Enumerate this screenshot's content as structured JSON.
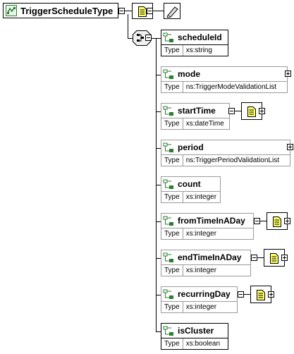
{
  "root": {
    "name": "TriggerScheduleType"
  },
  "type_label": "Type",
  "elements": [
    {
      "name": "scheduleId",
      "type": "xs:string"
    },
    {
      "name": "mode",
      "type": "ns:TriggerModeValidationList"
    },
    {
      "name": "startTime",
      "type": "xs:dateTime"
    },
    {
      "name": "period",
      "type": "ns:TriggerPeriodValidationList"
    },
    {
      "name": "count",
      "type": "xs:integer"
    },
    {
      "name": "fromTimeInADay",
      "type": "xs:integer"
    },
    {
      "name": "endTimeInADay",
      "type": "xs:integer"
    },
    {
      "name": "recurringDay",
      "type": "xs:integer"
    },
    {
      "name": "isCluster",
      "type": "xs:boolean"
    }
  ],
  "colors": {
    "note_fill": "#ffff66",
    "icon_green": "#2e7d32"
  }
}
